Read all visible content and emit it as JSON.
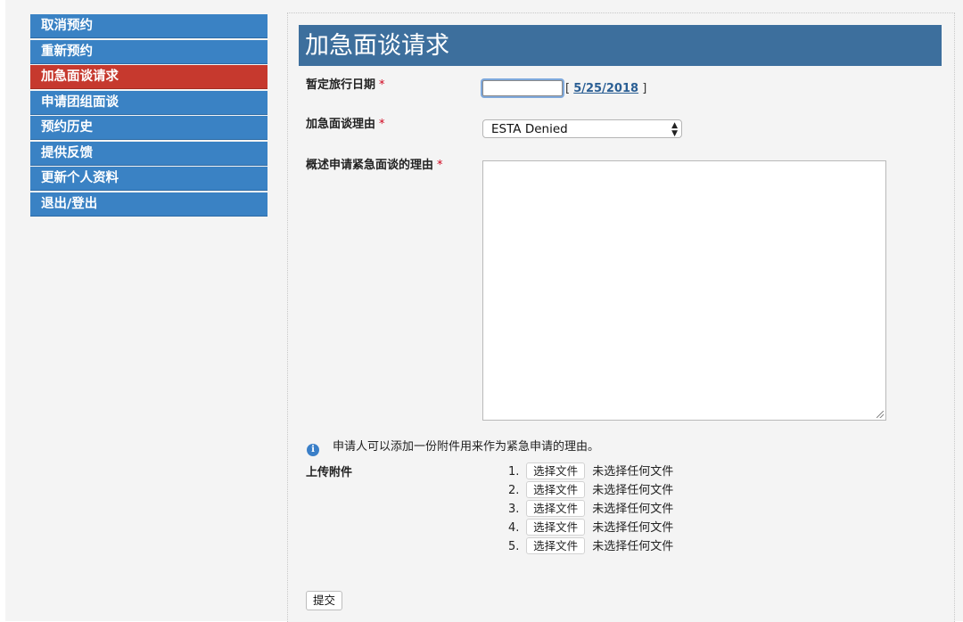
{
  "sidebar": {
    "items": [
      {
        "label": "取消预约"
      },
      {
        "label": "重新预约"
      },
      {
        "label": "加急面谈请求"
      },
      {
        "label": "申请团组面谈"
      },
      {
        "label": "预约历史"
      },
      {
        "label": "提供反馈"
      },
      {
        "label": "更新个人资料"
      },
      {
        "label": "退出/登出"
      }
    ],
    "active_index": 2
  },
  "main": {
    "title": "加急面谈请求",
    "required_mark": "*",
    "travel_date": {
      "label": "暂定旅行日期",
      "value": "",
      "link_prefix": "[",
      "link_text": "5/25/2018",
      "link_suffix": "]"
    },
    "reason": {
      "label": "加急面谈理由",
      "selected": "ESTA Denied"
    },
    "description": {
      "label": "概述申请紧急面谈的理由",
      "value": ""
    },
    "info_text": "申请人可以添加一份附件用来作为紧急申请的理由。",
    "upload": {
      "label": "上传附件",
      "rows": [
        {
          "num": "1.",
          "button": "选择文件",
          "status": "未选择任何文件"
        },
        {
          "num": "2.",
          "button": "选择文件",
          "status": "未选择任何文件"
        },
        {
          "num": "3.",
          "button": "选择文件",
          "status": "未选择任何文件"
        },
        {
          "num": "4.",
          "button": "选择文件",
          "status": "未选择任何文件"
        },
        {
          "num": "5.",
          "button": "选择文件",
          "status": "未选择任何文件"
        }
      ]
    },
    "submit_label": "提交"
  },
  "colors": {
    "sidebar_item": "#3a82c4",
    "sidebar_active": "#c6392e",
    "header_bar": "#3d6f9d",
    "required": "#d0021b",
    "link": "#2b5f94"
  },
  "icons": {
    "info": "info-circle-icon",
    "select_arrows": "up-down-arrows-icon",
    "resize_grip": "resize-grip-icon"
  }
}
